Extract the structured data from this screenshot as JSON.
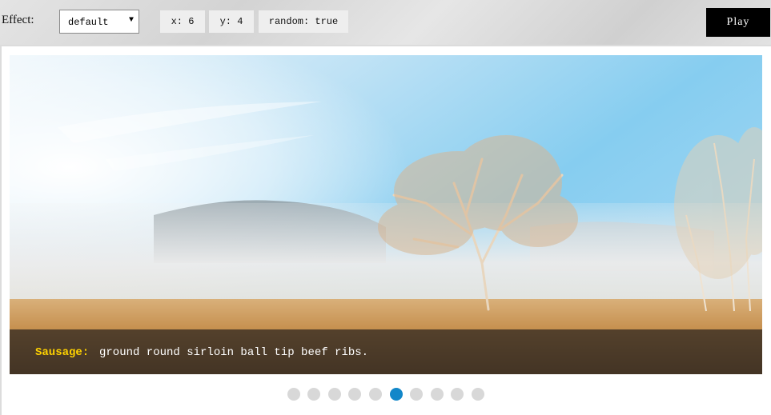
{
  "toolbar": {
    "effect_label": "Effect:",
    "effect_value": "default",
    "x_param": "x: 6",
    "y_param": "y: 4",
    "random_param": "random: true",
    "play_label": "Play"
  },
  "slide": {
    "caption_title": "Sausage:",
    "caption_text": "ground round sirloin ball tip beef ribs."
  },
  "pagination": {
    "count": 10,
    "active_index": 5,
    "active_color": "#1287c9",
    "inactive_color": "#d8d8d8"
  }
}
